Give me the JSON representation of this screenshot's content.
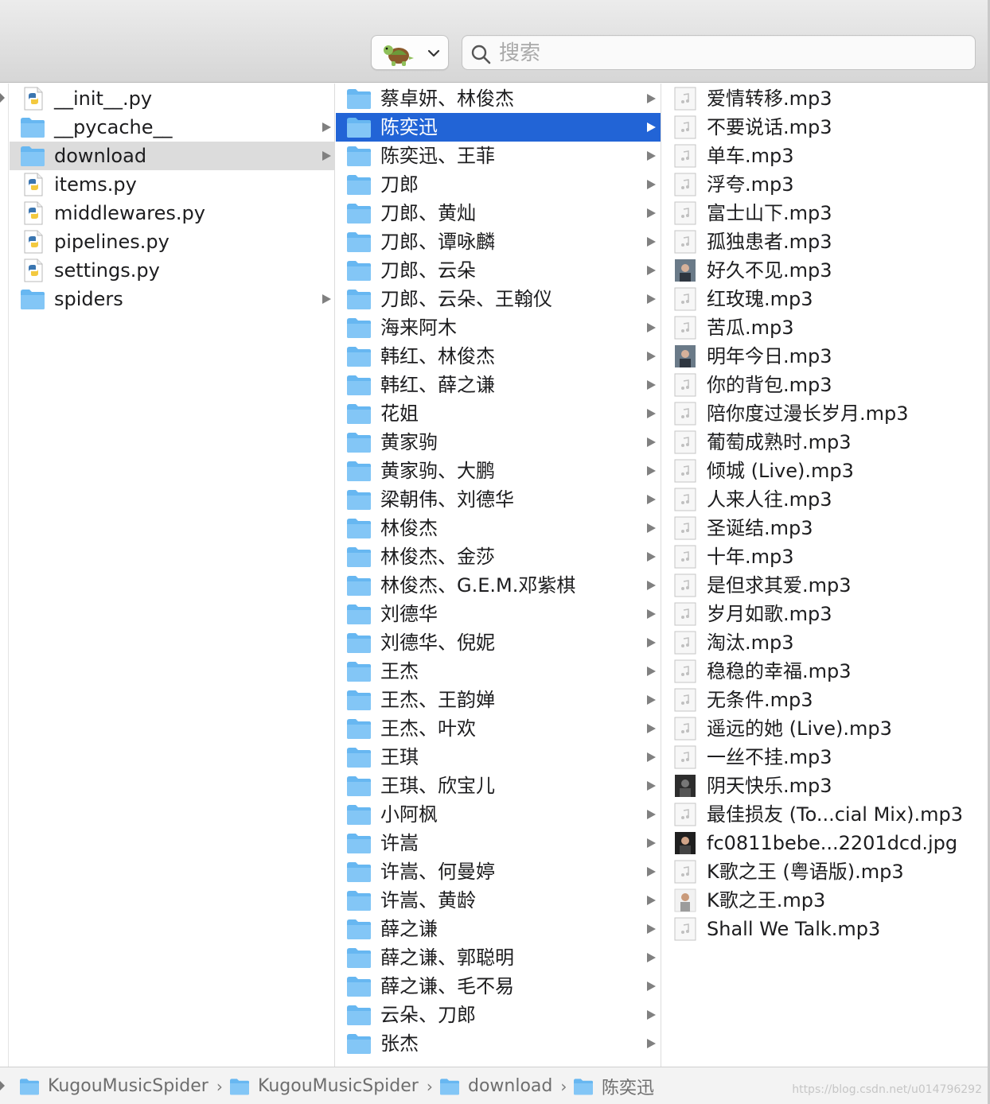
{
  "toolbar": {
    "action_icon": "turtle-icon",
    "action_chevron": "chevron-down-icon",
    "search_placeholder": "搜索",
    "search_icon": "magnifier-icon"
  },
  "column1": {
    "items": [
      {
        "label": "__init__.py",
        "icon": "python-file-icon",
        "folder": false
      },
      {
        "label": "__pycache__",
        "icon": "folder-icon",
        "folder": true
      },
      {
        "label": "download",
        "icon": "folder-icon",
        "folder": true,
        "selected": true
      },
      {
        "label": "items.py",
        "icon": "python-file-icon",
        "folder": false
      },
      {
        "label": "middlewares.py",
        "icon": "python-file-icon",
        "folder": false
      },
      {
        "label": "pipelines.py",
        "icon": "python-file-icon",
        "folder": false
      },
      {
        "label": "settings.py",
        "icon": "python-file-icon",
        "folder": false
      },
      {
        "label": "spiders",
        "icon": "folder-icon",
        "folder": true
      }
    ]
  },
  "column2": {
    "items": [
      "蔡卓妍、林俊杰",
      "陈奕迅",
      "陈奕迅、王菲",
      "刀郎",
      "刀郎、黄灿",
      "刀郎、谭咏麟",
      "刀郎、云朵",
      "刀郎、云朵、王翰仪",
      "海来阿木",
      "韩红、林俊杰",
      "韩红、薛之谦",
      "花姐",
      "黄家驹",
      "黄家驹、大鹏",
      "梁朝伟、刘德华",
      "林俊杰",
      "林俊杰、金莎",
      "林俊杰、G.E.M.邓紫棋",
      "刘德华",
      "刘德华、倪妮",
      "王杰",
      "王杰、王韵婵",
      "王杰、叶欢",
      "王琪",
      "王琪、欣宝儿",
      "小阿枫",
      "许嵩",
      "许嵩、何曼婷",
      "许嵩、黄龄",
      "薛之谦",
      "薛之谦、郭聪明",
      "薛之谦、毛不易",
      "云朵、刀郎",
      "张杰"
    ],
    "selected_index": 1
  },
  "column3": {
    "items": [
      {
        "label": "爱情转移.mp3",
        "icon": "audio-file-icon"
      },
      {
        "label": "不要说话.mp3",
        "icon": "audio-file-icon"
      },
      {
        "label": "单车.mp3",
        "icon": "audio-file-icon"
      },
      {
        "label": "浮夸.mp3",
        "icon": "audio-file-icon"
      },
      {
        "label": "富士山下.mp3",
        "icon": "audio-file-icon"
      },
      {
        "label": "孤独患者.mp3",
        "icon": "audio-file-icon"
      },
      {
        "label": "好久不见.mp3",
        "icon": "album-art-thumbnail"
      },
      {
        "label": "红玫瑰.mp3",
        "icon": "audio-file-icon"
      },
      {
        "label": "苦瓜.mp3",
        "icon": "audio-file-icon"
      },
      {
        "label": "明年今日.mp3",
        "icon": "album-art-thumbnail"
      },
      {
        "label": "你的背包.mp3",
        "icon": "audio-file-icon"
      },
      {
        "label": "陪你度过漫长岁月.mp3",
        "icon": "audio-file-icon"
      },
      {
        "label": "葡萄成熟时.mp3",
        "icon": "audio-file-icon"
      },
      {
        "label": "倾城 (Live).mp3",
        "icon": "audio-file-icon"
      },
      {
        "label": "人来人往.mp3",
        "icon": "audio-file-icon"
      },
      {
        "label": "圣诞结.mp3",
        "icon": "audio-file-icon"
      },
      {
        "label": "十年.mp3",
        "icon": "audio-file-icon"
      },
      {
        "label": "是但求其爱.mp3",
        "icon": "audio-file-icon"
      },
      {
        "label": "岁月如歌.mp3",
        "icon": "audio-file-icon"
      },
      {
        "label": "淘汰.mp3",
        "icon": "audio-file-icon"
      },
      {
        "label": "稳稳的幸福.mp3",
        "icon": "audio-file-icon"
      },
      {
        "label": "无条件.mp3",
        "icon": "audio-file-icon"
      },
      {
        "label": "遥远的她 (Live).mp3",
        "icon": "audio-file-icon"
      },
      {
        "label": "一丝不挂.mp3",
        "icon": "audio-file-icon"
      },
      {
        "label": "阴天快乐.mp3",
        "icon": "album-art-thumbnail-dark"
      },
      {
        "label": "最佳损友 (To...cial Mix).mp3",
        "icon": "audio-file-icon"
      },
      {
        "label": "fc0811bebe...2201dcd.jpg",
        "icon": "image-thumbnail"
      },
      {
        "label": "K歌之王 (粤语版).mp3",
        "icon": "audio-file-icon"
      },
      {
        "label": "K歌之王.mp3",
        "icon": "album-art-thumbnail-light"
      },
      {
        "label": "Shall We Talk.mp3",
        "icon": "audio-file-icon"
      }
    ]
  },
  "pathbar": {
    "crumbs": [
      "KugouMusicSpider",
      "KugouMusicSpider",
      "download",
      "陈奕迅"
    ],
    "separator": "›",
    "crumb_icon": "folder-icon"
  },
  "watermark": "https://blog.csdn.net/u014796292",
  "colors": {
    "selection_blue": "#2264d6",
    "selection_grey": "#dcdcdc",
    "folder_blue": "#5fb4f3"
  }
}
